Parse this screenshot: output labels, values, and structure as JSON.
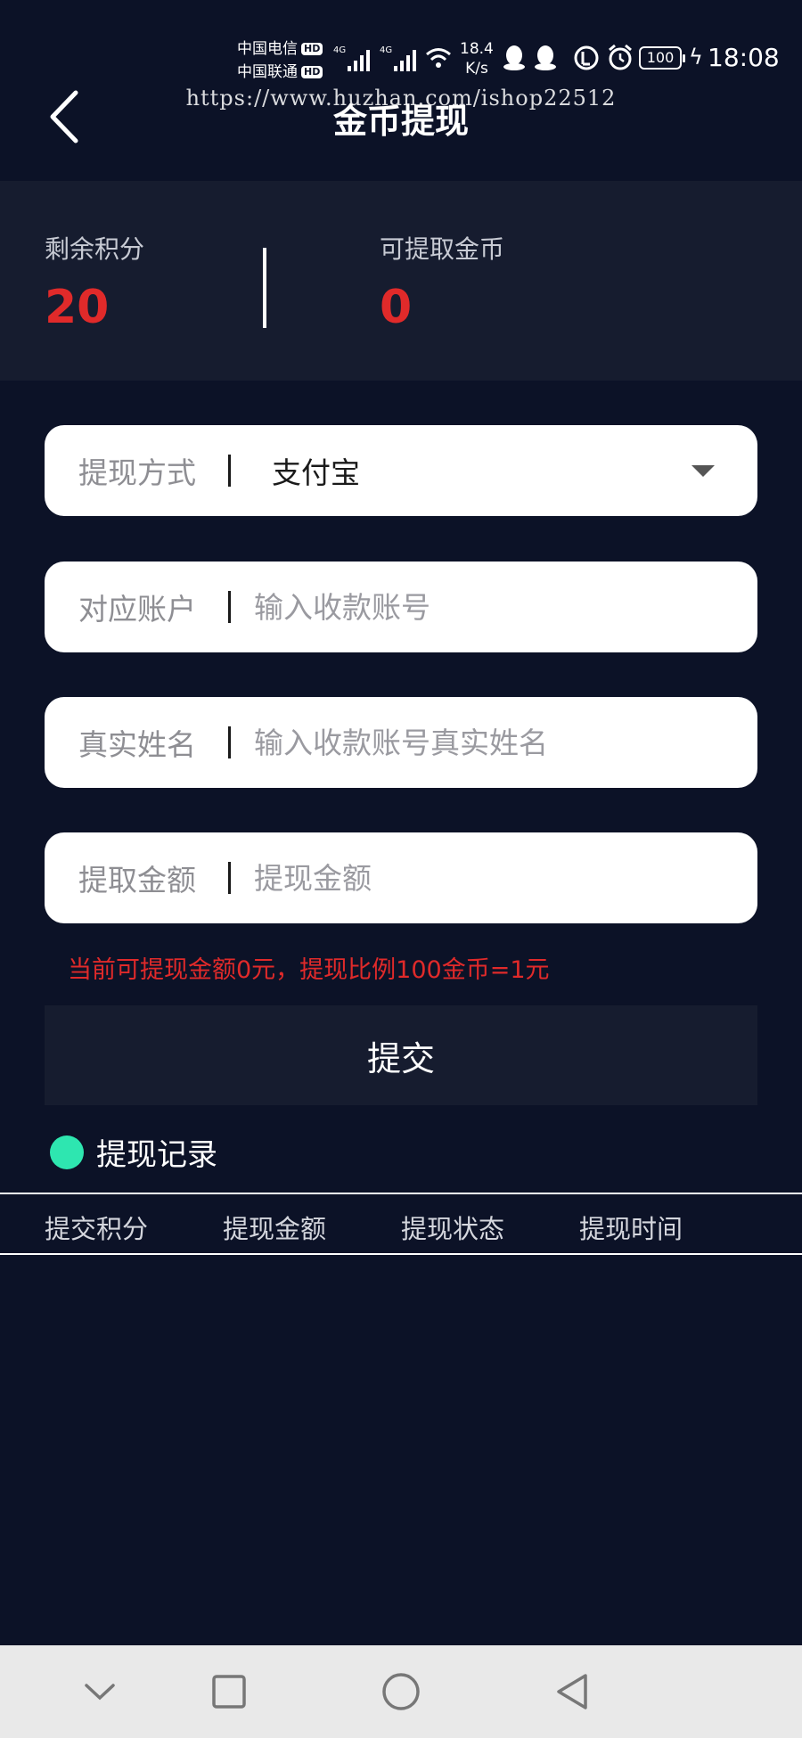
{
  "status_bar": {
    "carrier_1": "中国电信",
    "carrier_2": "中国联通",
    "hd_badge": "HD",
    "network_type": "4G",
    "net_speed_value": "18.4",
    "net_speed_unit": "K/s",
    "battery": "100",
    "time": "18:08"
  },
  "header": {
    "title": "金币提现",
    "back_icon": "chevron-left-icon",
    "watermark": "https://www.huzhan.com/ishop22512"
  },
  "balance": {
    "points_label": "剩余积分",
    "points_value": "20",
    "coins_label": "可提取金币",
    "coins_value": "0",
    "value_color": "#e02a2a"
  },
  "form": {
    "method": {
      "label": "提现方式",
      "value": "支付宝"
    },
    "account": {
      "label": "对应账户",
      "placeholder": "输入收款账号"
    },
    "real_name": {
      "label": "真实姓名",
      "placeholder": "输入收款账号真实姓名"
    },
    "amount": {
      "label": "提取金额",
      "placeholder": "提现金额"
    }
  },
  "hint": "当前可提现金额0元，提现比例100金币=1元",
  "submit_label": "提交",
  "records": {
    "title": "提现记录",
    "accent_color": "#2ee6b0",
    "columns": [
      "提交积分",
      "提现金额",
      "提现状态",
      "提现时间"
    ]
  },
  "nav_bar": {
    "buttons": [
      "chevron-down-icon",
      "square-icon",
      "circle-icon",
      "triangle-back-icon"
    ]
  }
}
